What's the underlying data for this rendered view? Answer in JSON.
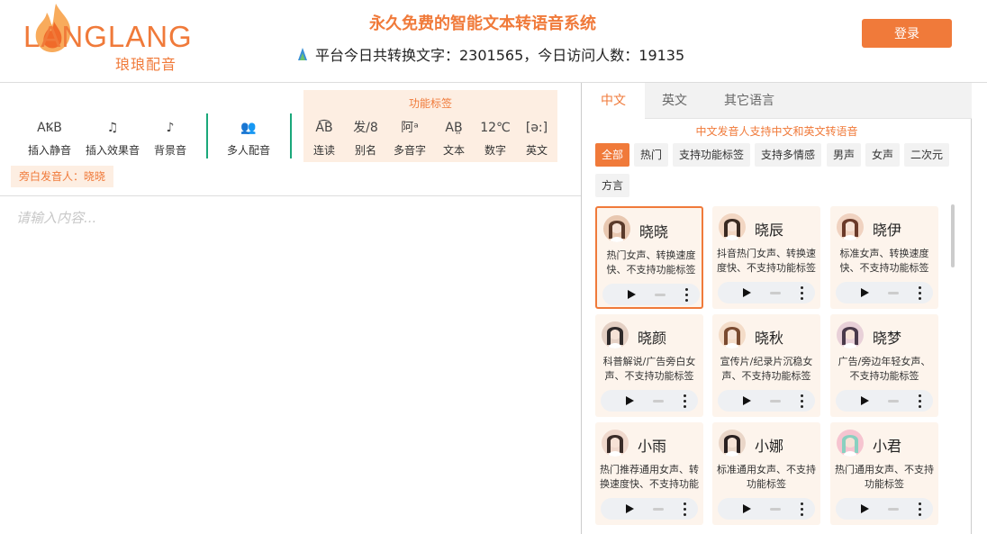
{
  "header": {
    "logo_text": "LANGLANG",
    "logo_sub": "琅琅配音",
    "title": "永久免费的智能文本转语音系统",
    "stats": "平台今日共转换文字：2301565，今日访问人数：19135",
    "login_label": "登录"
  },
  "toolbar": {
    "tools": [
      {
        "icon": "AꝄB",
        "label": "插入静音"
      },
      {
        "icon": "♫",
        "label": "插入效果音"
      },
      {
        "icon": "♪",
        "label": "背景音"
      },
      {
        "icon": "👥",
        "label": "多人配音"
      }
    ],
    "func_title": "功能标签",
    "func_tools": [
      {
        "icon": "A͡B",
        "label": "连读"
      },
      {
        "icon": "发/8",
        "label": "别名"
      },
      {
        "icon": "阿ᵃ",
        "label": "多音字"
      },
      {
        "icon": "AB̤",
        "label": "文本"
      },
      {
        "icon": "12℃",
        "label": "数字"
      },
      {
        "icon": "[ə:]",
        "label": "英文"
      }
    ],
    "narrator": "旁白发音人：晓晓"
  },
  "editor": {
    "placeholder": "请输入内容..."
  },
  "panel": {
    "tabs": [
      "中文",
      "英文",
      "其它语言"
    ],
    "support_note": "中文发音人支持中文和英文转语音",
    "filters": [
      "全部",
      "热门",
      "支持功能标签",
      "支持多情感",
      "男声",
      "女声",
      "二次元",
      "方言"
    ],
    "voices": [
      {
        "name": "晓晓",
        "desc": "热门女声、转换速度快、不支持功能标签"
      },
      {
        "name": "晓辰",
        "desc": "抖音热门女声、转换速度快、不支持功能标签"
      },
      {
        "name": "晓伊",
        "desc": "标准女声、转换速度快、不支持功能标签"
      },
      {
        "name": "晓颜",
        "desc": "科普解说/广告旁白女声、不支持功能标签"
      },
      {
        "name": "晓秋",
        "desc": "宣传片/纪录片沉稳女声、不支持功能标签"
      },
      {
        "name": "晓梦",
        "desc": "广告/旁边年轻女声、不支持功能标签"
      },
      {
        "name": "小雨",
        "desc": "热门推荐通用女声、转换速度快、不支持功能标签"
      },
      {
        "name": "小娜",
        "desc": "标准通用女声、不支持功能标签"
      },
      {
        "name": "小君",
        "desc": "热门通用女声、不支持功能标签"
      }
    ]
  },
  "colors": {
    "accent": "#f07a3a",
    "accent_light": "#fdeee2",
    "separator": "#1aa87a"
  }
}
